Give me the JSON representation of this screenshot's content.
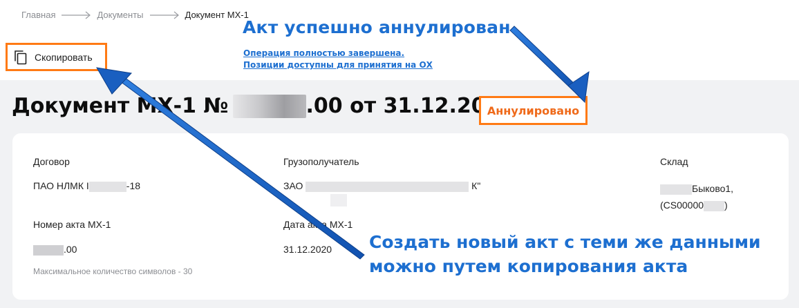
{
  "breadcrumb": {
    "items": [
      "Главная",
      "Документы",
      "Документ МХ-1"
    ]
  },
  "toolbar": {
    "copy_label": "Скопировать"
  },
  "callout_status": {
    "title": "Акт успешно аннулирован",
    "line1": "Операция полностью завершена.",
    "line2": "Позиции доступны для принятия на ОХ"
  },
  "document": {
    "title_prefix": "Документ МХ-1 №",
    "title_suffix": ".00 от 31.12.2020",
    "status": "Аннулировано"
  },
  "fields": {
    "contract_label": "Договор",
    "contract_value_start": "ПАО НЛМК I",
    "contract_value_end": "-18",
    "consignee_label": "Грузополучатель",
    "consignee_value_start": "ЗАО",
    "consignee_value_end": "К\"",
    "warehouse_label": "Склад",
    "warehouse_value_line1": "Быково1,",
    "warehouse_value_line2_start": "(CS00000",
    "warehouse_value_line2_end": ")",
    "act_number_label": "Номер акта МХ-1",
    "act_number_value_end": ".00",
    "act_number_hint": "Максимальное количество символов - 30",
    "act_date_label": "Дата акта МХ-1",
    "act_date_value": "31.12.2020"
  },
  "callout_copy": {
    "line1": "Создать новый акт с теми же данными",
    "line2": "можно путем копирования акта"
  },
  "colors": {
    "accent_orange": "#ff7a14",
    "annotation_blue": "#1d6fd0",
    "background_gray": "#f1f2f4"
  },
  "icons": {
    "copy": "copy-icon",
    "breadcrumb_separator": "arrow-right-icon"
  }
}
